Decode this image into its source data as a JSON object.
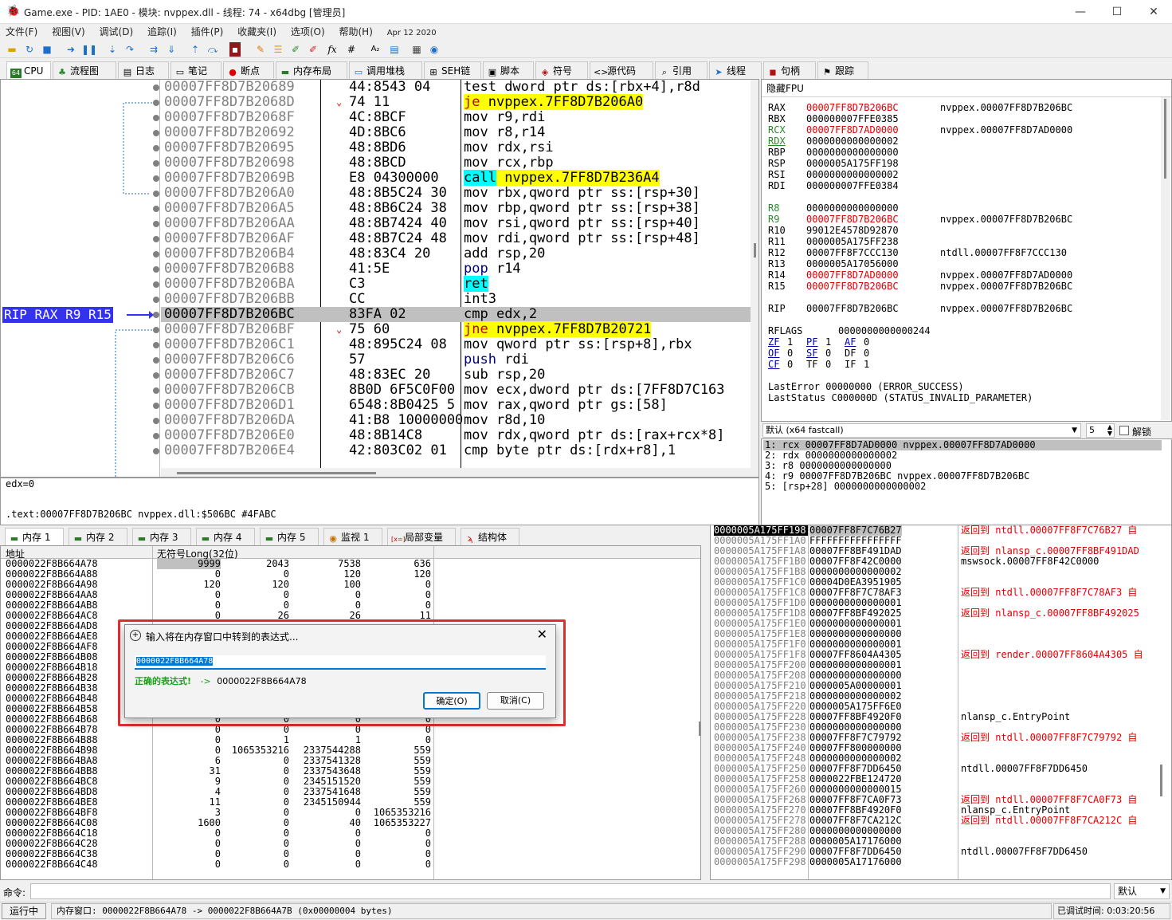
{
  "window": {
    "title": "Game.exe - PID: 1AE0 - 模块: nvppex.dll - 线程: 74 - x64dbg [管理员]",
    "minimize": "—",
    "maximize": "☐",
    "close": "✕"
  },
  "menu": [
    "文件(F)",
    "视图(V)",
    "调试(D)",
    "追踪(I)",
    "插件(P)",
    "收藏夹(I)",
    "选项(O)",
    "帮助(H)",
    "Apr 12 2020"
  ],
  "tabs": [
    {
      "label": "CPU",
      "icon": "cpu-icon",
      "active": true
    },
    {
      "label": "流程图",
      "icon": "graph-icon"
    },
    {
      "label": "日志",
      "icon": "log-icon"
    },
    {
      "label": "笔记",
      "icon": "notes-icon"
    },
    {
      "label": "断点",
      "icon": "breakpoint-icon"
    },
    {
      "label": "内存布局",
      "icon": "memory-map-icon"
    },
    {
      "label": "调用堆栈",
      "icon": "callstack-icon"
    },
    {
      "label": "SEH链",
      "icon": "seh-icon"
    },
    {
      "label": "脚本",
      "icon": "script-icon"
    },
    {
      "label": "符号",
      "icon": "symbols-icon"
    },
    {
      "label": "源代码",
      "icon": "source-icon"
    },
    {
      "label": "引用",
      "icon": "references-icon"
    },
    {
      "label": "线程",
      "icon": "threads-icon"
    },
    {
      "label": "句柄",
      "icon": "handles-icon"
    },
    {
      "label": "跟踪",
      "icon": "trace-icon"
    }
  ],
  "disasm": {
    "rip_label": "RIP RAX R9 R15",
    "rows": [
      {
        "addr": "00007FF8D7B20689",
        "bytes": "44:8543 04"
      },
      {
        "addr": "00007FF8D7B2068D",
        "bytes": "74 11",
        "arrow": "⌄"
      },
      {
        "addr": "00007FF8D7B2068F",
        "bytes": "4C:8BCF"
      },
      {
        "addr": "00007FF8D7B20692",
        "bytes": "4D:8BC6"
      },
      {
        "addr": "00007FF8D7B20695",
        "bytes": "48:8BD6"
      },
      {
        "addr": "00007FF8D7B20698",
        "bytes": "48:8BCD"
      },
      {
        "addr": "00007FF8D7B2069B",
        "bytes": "E8 04300000"
      },
      {
        "addr": "00007FF8D7B206A0",
        "bytes": "48:8B5C24 30"
      },
      {
        "addr": "00007FF8D7B206A5",
        "bytes": "48:8B6C24 38"
      },
      {
        "addr": "00007FF8D7B206AA",
        "bytes": "48:8B7424 40"
      },
      {
        "addr": "00007FF8D7B206AF",
        "bytes": "48:8B7C24 48"
      },
      {
        "addr": "00007FF8D7B206B4",
        "bytes": "48:83C4 20"
      },
      {
        "addr": "00007FF8D7B206B8",
        "bytes": "41:5E"
      },
      {
        "addr": "00007FF8D7B206BA",
        "bytes": "C3"
      },
      {
        "addr": "00007FF8D7B206BB",
        "bytes": "CC"
      },
      {
        "addr": "00007FF8D7B206BC",
        "bytes": "83FA 02"
      },
      {
        "addr": "00007FF8D7B206BF",
        "bytes": "75 60",
        "arrow": "⌄"
      },
      {
        "addr": "00007FF8D7B206C1",
        "bytes": "48:895C24 08"
      },
      {
        "addr": "00007FF8D7B206C6",
        "bytes": "57"
      },
      {
        "addr": "00007FF8D7B206C7",
        "bytes": "48:83EC 20"
      },
      {
        "addr": "00007FF8D7B206CB",
        "bytes": "8B0D 6F5C0F00"
      },
      {
        "addr": "00007FF8D7B206D1",
        "bytes": "6548:8B0425 5"
      },
      {
        "addr": "00007FF8D7B206DA",
        "bytes": "41:B8 10000000"
      },
      {
        "addr": "00007FF8D7B206E0",
        "bytes": "48:8B14C8"
      },
      {
        "addr": "00007FF8D7B206E4",
        "bytes": "42:803C02 01"
      }
    ],
    "instructions": [
      [
        "test",
        " dword ptr ",
        "ds",
        ":[",
        "rbx+4",
        "],",
        "r8d"
      ],
      [
        "je",
        " nvppex.7FF8D7B206A0"
      ],
      [
        "mov",
        " r9,rdi"
      ],
      [
        "mov",
        " r8,r14"
      ],
      [
        "mov",
        " rdx,rsi"
      ],
      [
        "mov",
        " rcx,rbp"
      ],
      [
        "call",
        " nvppex.7FF8D7B236A4"
      ],
      [
        "mov",
        " rbx,qword ptr ss:[rsp+30]"
      ],
      [
        "mov",
        " rbp,qword ptr ss:[rsp+38]"
      ],
      [
        "mov",
        " rsi,qword ptr ss:[rsp+40]"
      ],
      [
        "mov",
        " rdi,qword ptr ss:[rsp+48]"
      ],
      [
        "add",
        " rsp,20"
      ],
      [
        "pop",
        " r14"
      ],
      [
        "ret",
        ""
      ],
      [
        "int3",
        ""
      ],
      [
        "cmp",
        " edx,2"
      ],
      [
        "jne",
        " nvppex.7FF8D7B20721"
      ],
      [
        "mov",
        " qword ptr ss:[rsp+8],rbx"
      ],
      [
        "push",
        " rdi"
      ],
      [
        "sub",
        " rsp,20"
      ],
      [
        "mov",
        " ecx,dword ptr ds:[7FF8D7C163"
      ],
      [
        "mov",
        " rax,qword ptr gs:[58]"
      ],
      [
        "mov",
        " r8d,10"
      ],
      [
        "mov",
        " rdx,qword ptr ds:[rax+rcx*8]"
      ],
      [
        "cmp",
        " byte ptr ds:[rdx+r8],1"
      ]
    ]
  },
  "info": {
    "line1": "edx=0",
    "line2": ".text:00007FF8D7B206BC nvppex.dll:$506BC #4FABC"
  },
  "registers": {
    "header": "隐藏FPU",
    "gp": [
      {
        "name": "RAX",
        "value": "00007FF8D7B206BC",
        "comment": "nvppex.00007FF8D7B206BC",
        "changed": true
      },
      {
        "name": "RBX",
        "value": "000000007FFE0385",
        "comment": ""
      },
      {
        "name": "RCX",
        "value": "00007FF8D7AD0000",
        "comment": "nvppex.00007FF8D7AD0000",
        "changed": true
      },
      {
        "name": "RDX",
        "value": "0000000000000002",
        "comment": ""
      },
      {
        "name": "RBP",
        "value": "0000000000000000",
        "comment": ""
      },
      {
        "name": "RSP",
        "value": "0000005A175FF198",
        "comment": ""
      },
      {
        "name": "RSI",
        "value": "0000000000000002",
        "comment": ""
      },
      {
        "name": "RDI",
        "value": "000000007FFE0384",
        "comment": ""
      }
    ],
    "ext": [
      {
        "name": "R8",
        "value": "0000000000000000",
        "comment": ""
      },
      {
        "name": "R9",
        "value": "00007FF8D7B206BC",
        "comment": "nvppex.00007FF8D7B206BC",
        "changed": true
      },
      {
        "name": "R10",
        "value": "99012E4578D92870",
        "comment": ""
      },
      {
        "name": "R11",
        "value": "0000005A175FF238",
        "comment": ""
      },
      {
        "name": "R12",
        "value": "00007FF8F7CCC130",
        "comment": "ntdll.00007FF8F7CCC130"
      },
      {
        "name": "R13",
        "value": "0000005A17056000",
        "comment": ""
      },
      {
        "name": "R14",
        "value": "00007FF8D7AD0000",
        "comment": "nvppex.00007FF8D7AD0000",
        "changed": true
      },
      {
        "name": "R15",
        "value": "00007FF8D7B206BC",
        "comment": "nvppex.00007FF8D7B206BC",
        "changed": true
      }
    ],
    "rip": {
      "name": "RIP",
      "value": "00007FF8D7B206BC",
      "comment": "nvppex.00007FF8D7B206BC"
    },
    "rflags_label": "RFLAGS",
    "rflags": "0000000000000244",
    "flags": [
      [
        "ZF",
        "1",
        "PF",
        "1",
        "AF",
        "0"
      ],
      [
        "OF",
        "0",
        "SF",
        "0",
        "DF",
        "0"
      ],
      [
        "CF",
        "0",
        "TF",
        "0",
        "IF",
        "1"
      ]
    ],
    "lasterror": "LastError  00000000 (ERROR_SUCCESS)",
    "laststatus": "LastStatus C000000D (STATUS_INVALID_PARAMETER)"
  },
  "callconv": {
    "value": "默认 (x64 fastcall)",
    "count": "5",
    "unlock_label": "解锁"
  },
  "args": [
    "1: rcx 00007FF8D7AD0000 nvppex.00007FF8D7AD0000",
    "2: rdx 0000000000000002",
    "3: r8 0000000000000000",
    "4: r9 00007FF8D7B206BC nvppex.00007FF8D7B206BC",
    "5: [rsp+28] 0000000000000002"
  ],
  "memtabs": [
    "内存 1",
    "内存 2",
    "内存 3",
    "内存 4",
    "内存 5",
    "监视 1",
    "局部变量",
    "结构体"
  ],
  "dump": {
    "col_addr": "地址",
    "col_data": "无符号Long(32位)",
    "rows": [
      [
        "0000022F8B664A78",
        "9999",
        "2043",
        "7538",
        "636"
      ],
      [
        "0000022F8B664A88",
        "0",
        "0",
        "120",
        "120"
      ],
      [
        "0000022F8B664A98",
        "120",
        "120",
        "100",
        "0"
      ],
      [
        "0000022F8B664AA8",
        "0",
        "0",
        "0",
        "0"
      ],
      [
        "0000022F8B664AB8",
        "0",
        "0",
        "0",
        "0"
      ],
      [
        "0000022F8B664AC8",
        "0",
        "26",
        "26",
        "11"
      ],
      [
        "0000022F8B664AD8",
        "",
        "",
        "",
        ""
      ],
      [
        "0000022F8B664AE8",
        "",
        "",
        "",
        ""
      ],
      [
        "0000022F8B664AF8",
        "",
        "",
        "",
        ""
      ],
      [
        "0000022F8B664B08",
        "",
        "",
        "",
        ""
      ],
      [
        "0000022F8B664B18",
        "",
        "",
        "",
        ""
      ],
      [
        "0000022F8B664B28",
        "",
        "",
        "",
        ""
      ],
      [
        "0000022F8B664B38",
        "",
        "",
        "",
        ""
      ],
      [
        "0000022F8B664B48",
        "",
        "",
        "",
        ""
      ],
      [
        "0000022F8B664B58",
        "",
        "",
        "",
        ""
      ],
      [
        "0000022F8B664B68",
        "0",
        "0",
        "0",
        "0"
      ],
      [
        "0000022F8B664B78",
        "0",
        "0",
        "0",
        "0"
      ],
      [
        "0000022F8B664B88",
        "0",
        "1",
        "1",
        "0"
      ],
      [
        "0000022F8B664B98",
        "0",
        "1065353216",
        "2337544288",
        "559"
      ],
      [
        "0000022F8B664BA8",
        "6",
        "0",
        "2337541328",
        "559"
      ],
      [
        "0000022F8B664BB8",
        "31",
        "0",
        "2337543648",
        "559"
      ],
      [
        "0000022F8B664BC8",
        "9",
        "0",
        "2345151520",
        "559"
      ],
      [
        "0000022F8B664BD8",
        "4",
        "0",
        "2337541648",
        "559"
      ],
      [
        "0000022F8B664BE8",
        "11",
        "0",
        "2345150944",
        "559"
      ],
      [
        "0000022F8B664BF8",
        "3",
        "0",
        "0",
        "1065353216"
      ],
      [
        "0000022F8B664C08",
        "1600",
        "0",
        "40",
        "1065353227"
      ],
      [
        "0000022F8B664C18",
        "0",
        "0",
        "0",
        "0"
      ],
      [
        "0000022F8B664C28",
        "0",
        "0",
        "0",
        "0"
      ],
      [
        "0000022F8B664C38",
        "0",
        "0",
        "0",
        "0"
      ],
      [
        "0000022F8B664C48",
        "0",
        "0",
        "0",
        "0"
      ]
    ]
  },
  "stack": {
    "rows": [
      [
        "0000005A175FF198",
        "00007FF8F7C76B27",
        "返回到 ntdll.00007FF8F7C76B27 自",
        "red"
      ],
      [
        "0000005A175FF1A0",
        "FFFFFFFFFFFFFFFF",
        "",
        ""
      ],
      [
        "0000005A175FF1A8",
        "00007FF8BF491DAD",
        "返回到 nlansp_c.00007FF8BF491DAD",
        "red"
      ],
      [
        "0000005A175FF1B0",
        "00007FF8F42C0000",
        "mswsock.00007FF8F42C0000",
        ""
      ],
      [
        "0000005A175FF1B8",
        "0000000000000002",
        "",
        ""
      ],
      [
        "0000005A175FF1C0",
        "00004D0EA3951905",
        "",
        ""
      ],
      [
        "0000005A175FF1C8",
        "00007FF8F7C78AF3",
        "返回到 ntdll.00007FF8F7C78AF3 自",
        "red"
      ],
      [
        "0000005A175FF1D0",
        "0000000000000001",
        "",
        ""
      ],
      [
        "0000005A175FF1D8",
        "00007FF8BF492025",
        "返回到 nlansp_c.00007FF8BF492025",
        "red"
      ],
      [
        "0000005A175FF1E0",
        "0000000000000001",
        "",
        ""
      ],
      [
        "0000005A175FF1E8",
        "0000000000000000",
        "",
        ""
      ],
      [
        "0000005A175FF1F0",
        "0000000000000001",
        "",
        ""
      ],
      [
        "0000005A175FF1F8",
        "00007FF8604A4305",
        "返回到 render.00007FF8604A4305 自",
        "red"
      ],
      [
        "0000005A175FF200",
        "0000000000000001",
        "",
        ""
      ],
      [
        "0000005A175FF208",
        "0000000000000000",
        "",
        ""
      ],
      [
        "0000005A175FF210",
        "0000005A00000001",
        "",
        ""
      ],
      [
        "0000005A175FF218",
        "0000000000000002",
        "",
        ""
      ],
      [
        "0000005A175FF220",
        "0000005A175FF6E0",
        "",
        ""
      ],
      [
        "0000005A175FF228",
        "00007FF8BF4920F0",
        "nlansp_c.EntryPoint",
        ""
      ],
      [
        "0000005A175FF230",
        "0000000000000000",
        "",
        ""
      ],
      [
        "0000005A175FF238",
        "00007FF8F7C79792",
        "返回到 ntdll.00007FF8F7C79792 自",
        "red"
      ],
      [
        "0000005A175FF240",
        "00007FF800000000",
        "",
        ""
      ],
      [
        "0000005A175FF248",
        "0000000000000002",
        "",
        ""
      ],
      [
        "0000005A175FF250",
        "00007FF8F7DD6450",
        "ntdll.00007FF8F7DD6450",
        ""
      ],
      [
        "0000005A175FF258",
        "0000022FBE124720",
        "",
        ""
      ],
      [
        "0000005A175FF260",
        "0000000000000015",
        "",
        ""
      ],
      [
        "0000005A175FF268",
        "00007FF8F7CA0F73",
        "返回到 ntdll.00007FF8F7CA0F73 自",
        "red"
      ],
      [
        "0000005A175FF270",
        "00007FF8BF4920F0",
        "nlansp_c.EntryPoint",
        ""
      ],
      [
        "0000005A175FF278",
        "00007FF8F7CA212C",
        "返回到 ntdll.00007FF8F7CA212C 自",
        "red"
      ],
      [
        "0000005A175FF280",
        "0000000000000000",
        "",
        ""
      ],
      [
        "0000005A175FF288",
        "0000005A17176000",
        "",
        ""
      ],
      [
        "0000005A175FF290",
        "00007FF8F7DD6450",
        "ntdll.00007FF8F7DD6450",
        ""
      ],
      [
        "0000005A175FF298",
        "0000005A17176000",
        "",
        ""
      ]
    ]
  },
  "command": {
    "label": "命令:",
    "value": "",
    "mode": "默认"
  },
  "status": {
    "state": "运行中",
    "message": "内存窗口: 0000022F8B664A78 -> 0000022F8B664A7B (0x00000004 bytes)",
    "time_label": "已调试时间:",
    "time": "0:03:20:56"
  },
  "dialog": {
    "title": "输入将在内存窗口中转到的表达式...",
    "input": "0000022F8B664A78",
    "ok_label": "正确的表达式!",
    "ok_arrow": "->",
    "ok_value": "0000022F8B664A78",
    "confirm": "确定(O)",
    "cancel": "取消(C)"
  },
  "colors": {
    "accent": "#0078d4",
    "highlight_frame": "#e03030",
    "rip_bg": "#3333ee",
    "changed_reg": "#e00000"
  }
}
